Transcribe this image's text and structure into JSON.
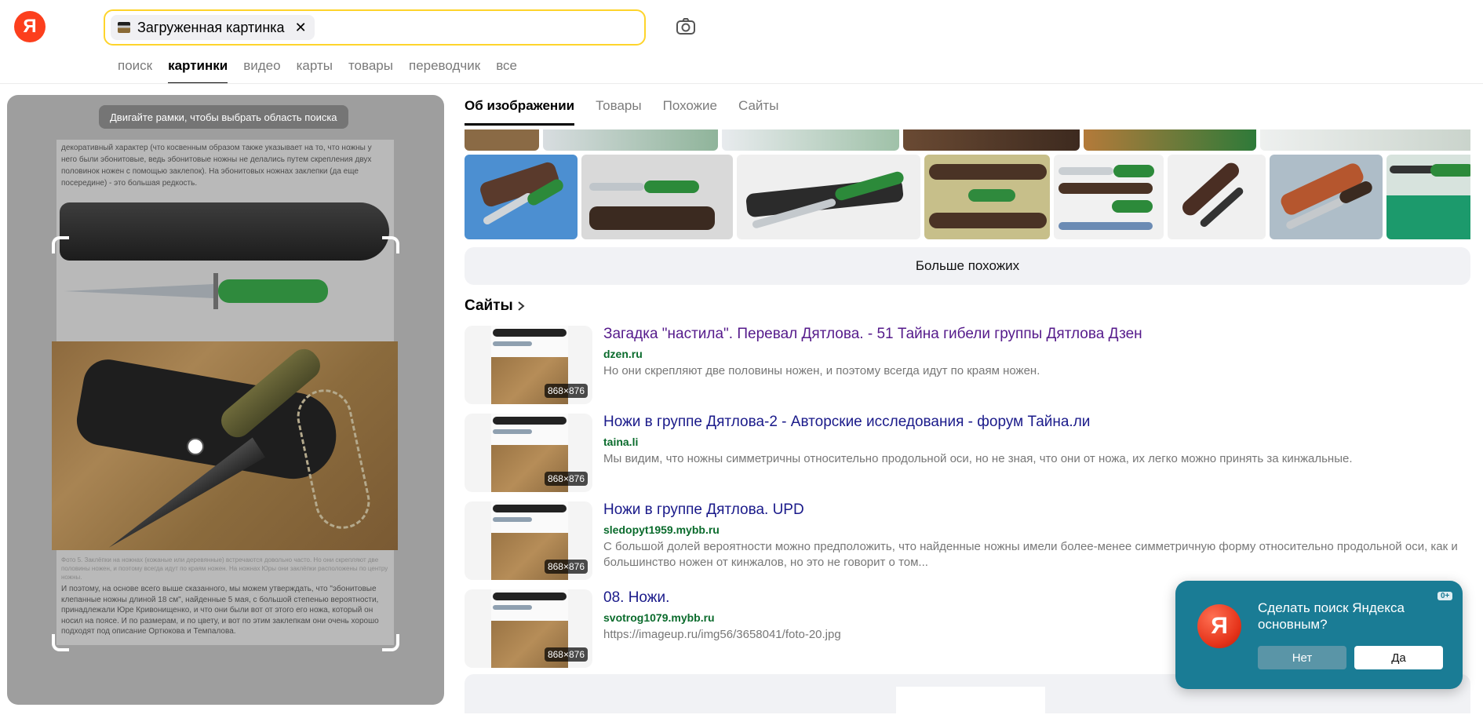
{
  "header": {
    "logo_letter": "Я",
    "search_chip_label": "Загруженная картинка",
    "chip_close": "✕",
    "nav_tabs": [
      "поиск",
      "картинки",
      "видео",
      "карты",
      "товары",
      "переводчик",
      "все"
    ],
    "active_tab": "картинки"
  },
  "preview": {
    "hint": "Двигайте рамки, чтобы выбрать область поиска",
    "doc_top_lines": [
      "декоративный характер (что косвенным образом также указывает на то, что ножны у",
      "него были эбонитовые, ведь эбонитовые ножны не делались путем скрепления двух",
      "половинок ножен с помощью заклепок). На эбонитовых ножнах заклепки (да еще",
      "посередине) - это большая редкость."
    ],
    "doc_caption": "Фото 5. Заклёпки на ножнах (кожаные или деревянные) встречаются довольно часто. Но они скрепляют две половины ножен, и поэтому всегда идут по краям ножен. На ножнах Юры они заклёпки расположены по центру ножны.",
    "doc_bottom_lines": [
      "И поэтому, на основе всего выше сказанного, мы можем утверждать, что \"эбонитовые",
      "клепанные ножны длиной 18 см\", найденные 5 мая, с большой степенью вероятности,",
      "принадлежали Юре Кривонищенко, и что они были вот от этого его ножа, который он",
      "носил на поясе. И по размерам, и по цвету, и вот по этим заклепкам они очень хорошо",
      "подходят под описание Ортюкова и Темпалова."
    ]
  },
  "results": {
    "sub_tabs": [
      "Об изображении",
      "Товары",
      "Похожие",
      "Сайты"
    ],
    "active_sub_tab": "Об изображении",
    "more_similar": "Больше похожих",
    "sites_heading": "Сайты",
    "sites": [
      {
        "title": "Загадка \"настила\". Перевал Дятлова. - 51 Тайна гибели группы Дятлова Дзен",
        "host": "dzen.ru",
        "desc": "Но они скрепляют две половины ножен, и поэтому всегда идут по краям ножен.",
        "size": "868×876"
      },
      {
        "title": "Ножи в группе Дятлова-2 - Авторские исследования - форум Тайна.ли",
        "host": "taina.li",
        "desc": "Мы видим, что ножны симметричны относительно продольной оси, но не зная, что они от ножа, их легко можно принять за кинжальные.",
        "size": "868×876"
      },
      {
        "title": "Ножи в группе Дятлова. UPD",
        "host": "sledopyt1959.mybb.ru",
        "desc": "С большой долей вероятности можно предположить, что найденные ножны имели более-менее симметричную форму относительно продольной оси, как и большинство ножен от кинжалов, но это не говорит о том...",
        "size": "868×876"
      },
      {
        "title": "08. Ножи.",
        "host": "svotrog1079.mybb.ru",
        "desc": "https://imageup.ru/img56/3658041/foto-20.jpg",
        "size": "868×876"
      }
    ]
  },
  "promo": {
    "logo_letter": "Я",
    "text": "Сделать поиск Яндекса основным?",
    "age": "0+",
    "no": "Нет",
    "yes": "Да"
  },
  "colors": {
    "accent_yellow": "#fed42b",
    "yandex_red": "#fc3f1d",
    "promo_bg": "#1a7c95",
    "host_green": "#0a6b2c"
  }
}
